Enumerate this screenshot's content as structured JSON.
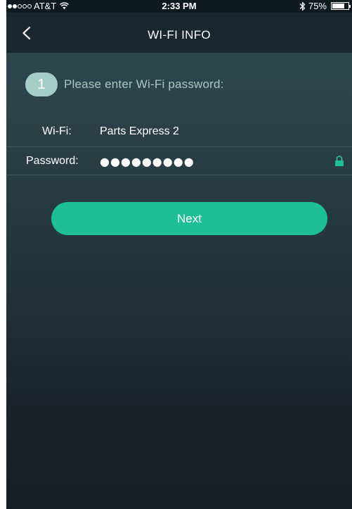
{
  "status_bar": {
    "carrier": "AT&T",
    "signal_bars_filled": 2,
    "signal_bars_total": 5,
    "time": "2:33 PM",
    "battery_percent": "75%",
    "battery_level": 0.75
  },
  "nav": {
    "title": "WI-FI INFO",
    "back_icon": "chevron-left-icon"
  },
  "step": {
    "number": "1",
    "instruction": "Please enter Wi-Fi password:"
  },
  "wifi": {
    "label": "Wi-Fi:",
    "network_name": "Parts Express 2"
  },
  "password": {
    "label": "Password:",
    "value": "●●●●●●●●●",
    "lock_icon": "lock-icon"
  },
  "actions": {
    "next_label": "Next"
  },
  "colors": {
    "accent": "#1fbf95",
    "badge": "#a5cfc6",
    "nav_background": "#18282e"
  }
}
